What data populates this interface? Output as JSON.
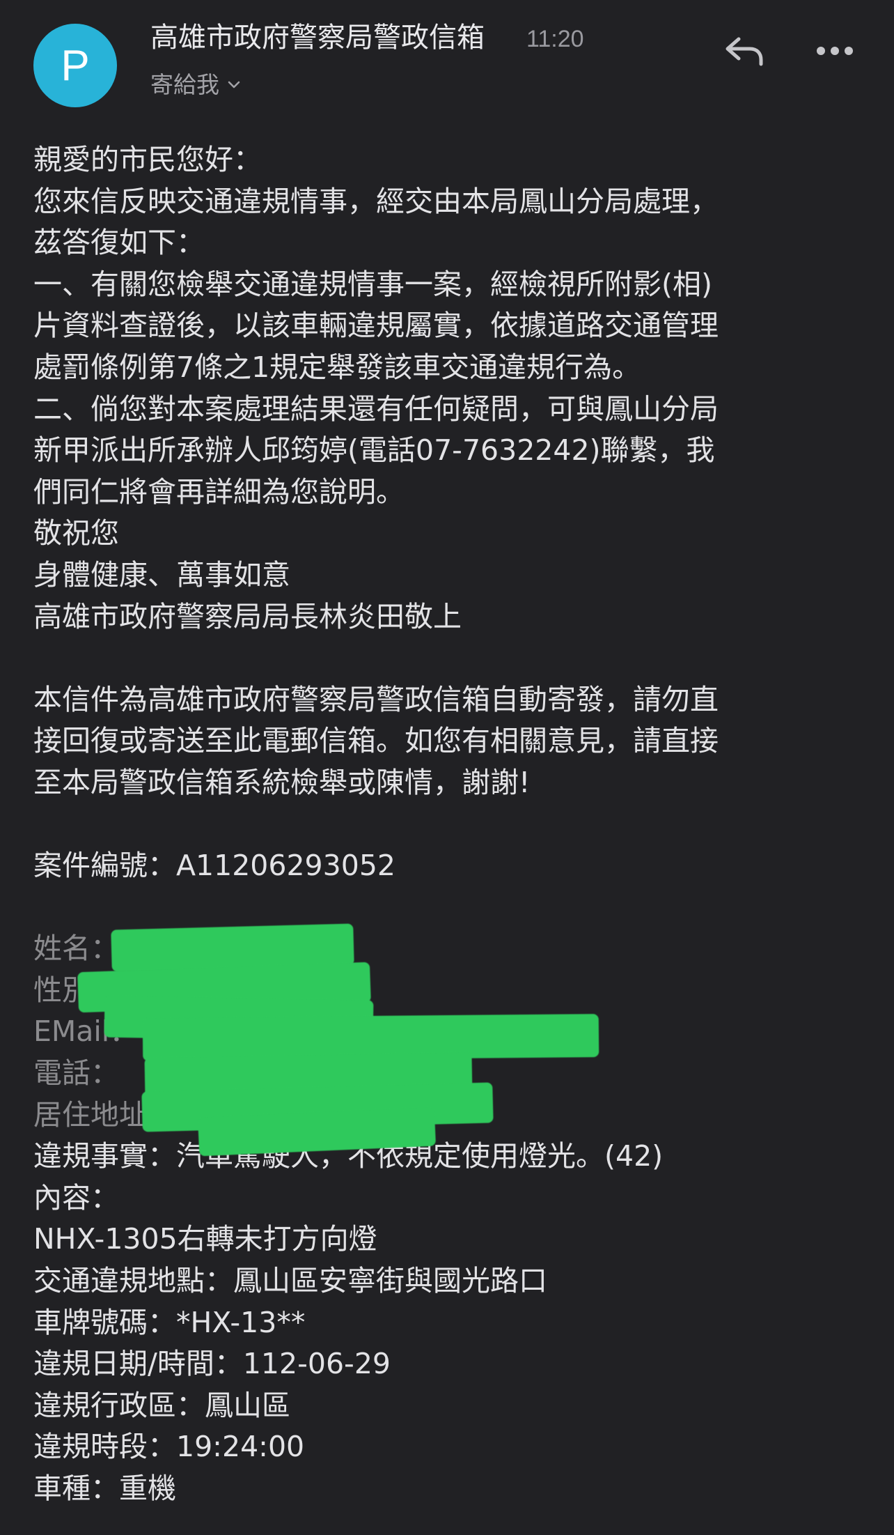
{
  "header": {
    "avatar_letter": "P",
    "sender": "高雄市政府警察局警政信箱",
    "time": "11:20",
    "to": "寄給我"
  },
  "icons": {
    "chevron": "chevron-down-icon",
    "reply": "reply-icon",
    "more": "more-horizontal-icon"
  },
  "colors": {
    "avatar": "#28b3d8",
    "background": "#212124",
    "redaction": "#2fc95c"
  },
  "body": {
    "greeting": "親愛的市民您好：",
    "p1": [
      "您來信反映交通違規情事，經交由本局鳳山分局處理，",
      "茲答復如下：",
      "一、有關您檢舉交通違規情事一案，經檢視所附影(相)",
      "片資料查證後，以該車輛違規屬實，依據道路交通管理",
      "處罰條例第7條之1規定舉發該車交通違規行為。",
      "二、倘您對本案處理結果還有任何疑問，可與鳳山分局",
      "新甲派出所承辦人邱筠婷(電話07-7632242)聯繫，我",
      "們同仁將會再詳細為您說明。",
      "敬祝您",
      "身體健康、萬事如意",
      "高雄市政府警察局局長林炎田敬上"
    ],
    "notice": [
      "本信件為高雄市政府警察局警政信箱自動寄發，請勿直",
      "接回復或寄送至此電郵信箱。如您有相關意見，請直接",
      "至本局警政信箱系統檢舉或陳情，謝謝!"
    ],
    "case_no": "案件編號：A11206293052",
    "personal": {
      "name_label": "姓名：",
      "gender_label": "性別：",
      "email_label": "EMail：",
      "phone_label": "電話：",
      "address_label": "居住地址："
    },
    "details": [
      "違規事實：汽車駕駛人，不依規定使用燈光。(42)",
      "內容：",
      "NHX-1305右轉未打方向燈",
      "交通違規地點：鳳山區安寧街與國光路口",
      "車牌號碼：*HX-13**",
      "違規日期/時間：112-06-29",
      "違規行政區：鳳山區",
      "違規時段：19:24:00",
      "車種：重機"
    ]
  }
}
